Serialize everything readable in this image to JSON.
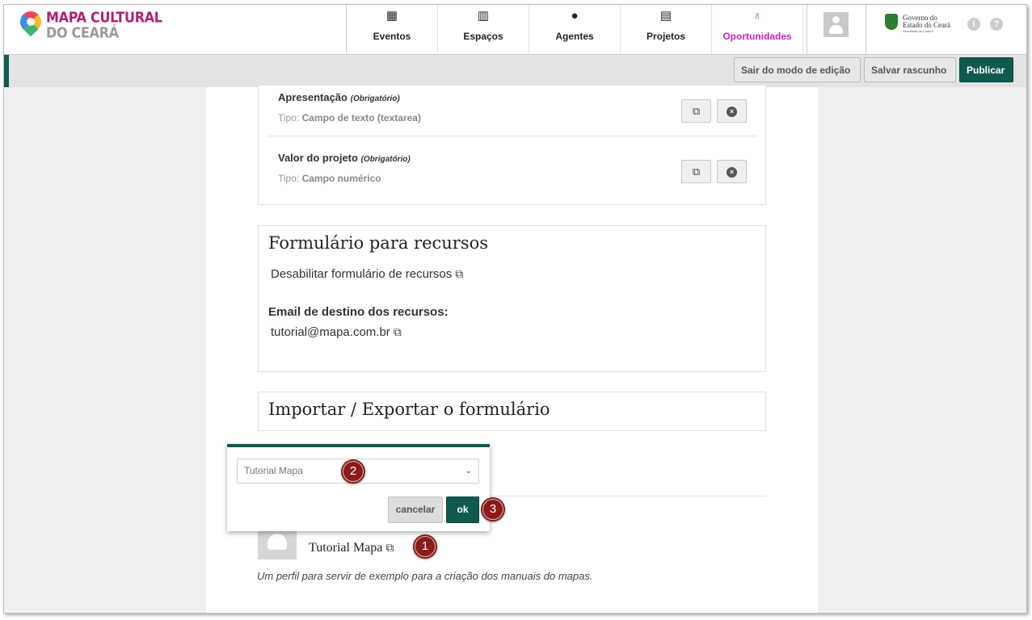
{
  "brand": {
    "line1": "MAPA CULTURAL",
    "line2": "DO CEARÁ"
  },
  "nav": [
    {
      "label": "Eventos",
      "icon": "calendar-icon",
      "glyph": "▦"
    },
    {
      "label": "Espaços",
      "icon": "building-icon",
      "glyph": "▥"
    },
    {
      "label": "Agentes",
      "icon": "person-icon",
      "glyph": "●"
    },
    {
      "label": "Projetos",
      "icon": "document-icon",
      "glyph": "▤"
    },
    {
      "label": "Oportunidades",
      "icon": "lightbulb-icon",
      "glyph": "♁"
    }
  ],
  "gov": {
    "line1": "Governo do",
    "line2": "Estado do Ceará",
    "line3": "Secretaria da Cultura"
  },
  "header_icons": {
    "info": "i",
    "help": "?"
  },
  "editbar": {
    "exit": "Sair do modo de edição",
    "draft": "Salvar rascunho",
    "publish": "Publicar"
  },
  "fields": [
    {
      "name": "Apresentação",
      "required": "(Obrigatório)",
      "type_prefix": "Tipo:",
      "type": "Campo de texto (textarea)"
    },
    {
      "name": "Valor do projeto",
      "required": "(Obrigatório)",
      "type_prefix": "Tipo:",
      "type": "Campo numérico"
    }
  ],
  "appeal": {
    "title": "Formulário para recursos",
    "disable_text": "Desabilitar formulário de recursos",
    "email_label": "Email de destino dos recursos:",
    "email_value": "tutorial@mapa.com.br"
  },
  "import_export": {
    "title": "Importar / Exportar o formulário"
  },
  "agent": {
    "name": "Tutorial Mapa",
    "description": "Um perfil para servir de exemplo para a criação dos manuais do mapas."
  },
  "popover": {
    "selected": "Tutorial Mapa",
    "cancel": "cancelar",
    "ok": "ok"
  },
  "badges": [
    "1",
    "2",
    "3"
  ],
  "colors": {
    "accent": "#0f5a4f",
    "active_nav": "#d21fc4",
    "badge": "#8b1a1a"
  }
}
